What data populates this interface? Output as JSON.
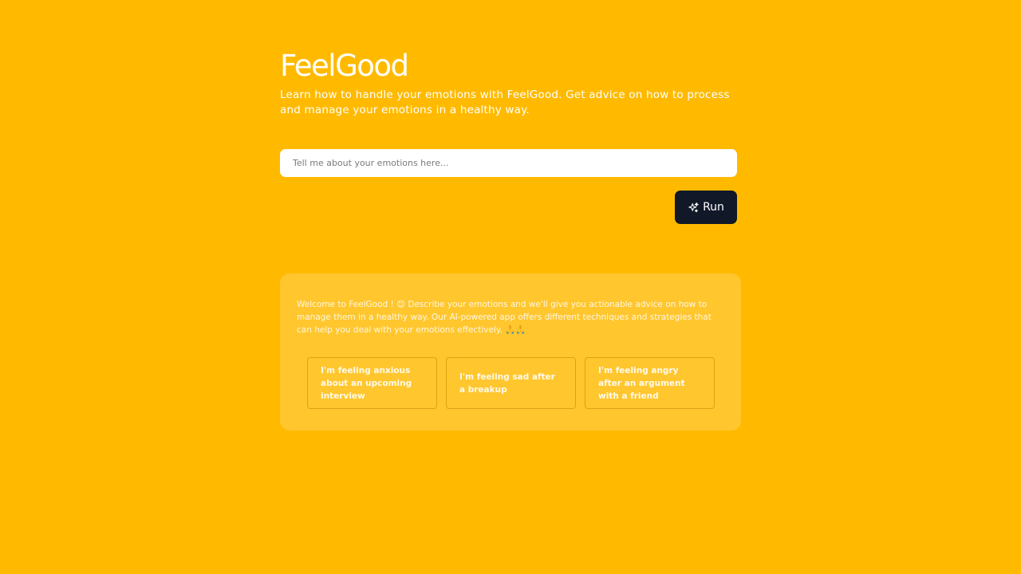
{
  "app": {
    "title": "FeelGood",
    "subtitle": "Learn how to handle your emotions with FeelGood. Get advice on how to process and manage your emotions in a healthy way."
  },
  "prompt": {
    "placeholder": "Tell me about your emotions here...",
    "value": ""
  },
  "run_button": {
    "label": "Run",
    "icon": "sparkles-icon"
  },
  "welcome": {
    "message": "Welcome to FeelGood ! 😊 Describe your emotions and we'll give you actionable advice on how to manage them in a healthy way. Our AI-powered app offers different techniques and strategies that can help you deal with your emotions effectively. 🙏🙏"
  },
  "suggestions": [
    "I'm feeling anxious about an upcoming interview",
    "I'm feeling sad after a breakup",
    "I'm feeling angry after an argument with a friend"
  ],
  "colors": {
    "background": "#FFBA00",
    "button": "#111827",
    "text": "#FFFFFF"
  }
}
